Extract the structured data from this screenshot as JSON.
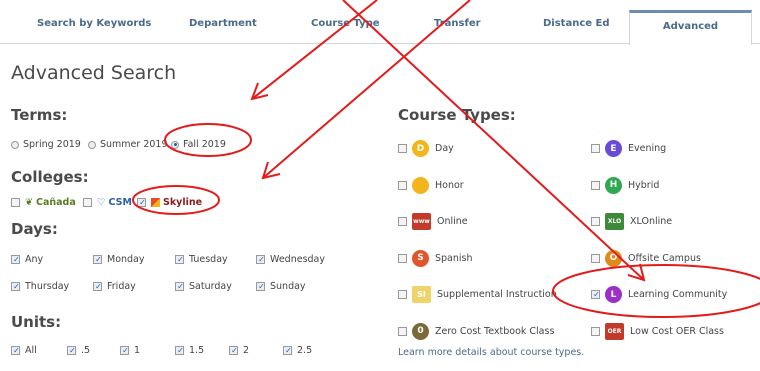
{
  "tabs": [
    "Search by Keywords",
    "Department",
    "Course Type",
    "Transfer",
    "Distance Ed",
    "Advanced"
  ],
  "page_title": "Advanced Search",
  "terms": {
    "heading": "Terms:",
    "options": [
      {
        "label": "Spring 2019",
        "selected": false
      },
      {
        "label": "Summer 2019",
        "selected": false
      },
      {
        "label": "Fall 2019",
        "selected": true
      }
    ]
  },
  "colleges": {
    "heading": "Colleges:",
    "options": [
      {
        "label": "Cañada",
        "checked": false
      },
      {
        "label": "CSM",
        "checked": false
      },
      {
        "label": "Skyline",
        "checked": true
      }
    ]
  },
  "days": {
    "heading": "Days:",
    "options": [
      "Any",
      "Monday",
      "Tuesday",
      "Wednesday",
      "Thursday",
      "Friday",
      "Saturday",
      "Sunday"
    ]
  },
  "units": {
    "heading": "Units:",
    "options": [
      "All",
      ".5",
      "1",
      "1.5",
      "2",
      "2.5"
    ]
  },
  "course_types": {
    "heading": "Course Types:",
    "items": [
      {
        "label": "Day",
        "icon": "sun-icon",
        "glyph": "D",
        "color": "#f2b51c"
      },
      {
        "label": "Evening",
        "icon": "evening-icon",
        "glyph": "E",
        "color": "#6a4bd8"
      },
      {
        "label": "Honor",
        "icon": "honor-medal-icon",
        "glyph": "",
        "color": "#f2b51c"
      },
      {
        "label": "Hybrid",
        "icon": "hybrid-icon",
        "glyph": "H",
        "color": "#2fa84f"
      },
      {
        "label": "Online",
        "icon": "online-icon",
        "glyph": "www",
        "color": "#c23b2a"
      },
      {
        "label": "XLOnline",
        "icon": "xlonline-icon",
        "glyph": "XLO",
        "color": "#3e8a3a"
      },
      {
        "label": "Spanish",
        "icon": "spanish-icon",
        "glyph": "S",
        "color": "#e0552b"
      },
      {
        "label": "Offsite Campus",
        "icon": "offsite-icon",
        "glyph": "O",
        "color": "#e08a1b"
      },
      {
        "label": "Supplemental Instruction",
        "icon": "si-icon",
        "glyph": "SI",
        "color": "#f0d46a"
      },
      {
        "label": "Learning Community",
        "icon": "learning-community-icon",
        "glyph": "L",
        "color": "#9b2fc7"
      },
      {
        "label": "Zero Cost Textbook Class",
        "icon": "zero-cost-book-icon",
        "glyph": "0",
        "color": "#7a6a3a"
      },
      {
        "label": "Low Cost OER Class",
        "icon": "oer-icon",
        "glyph": "OER",
        "color": "#c23b2a"
      }
    ],
    "checked": [
      "Learning Community"
    ]
  },
  "learn_more": "Learn more details about course types."
}
